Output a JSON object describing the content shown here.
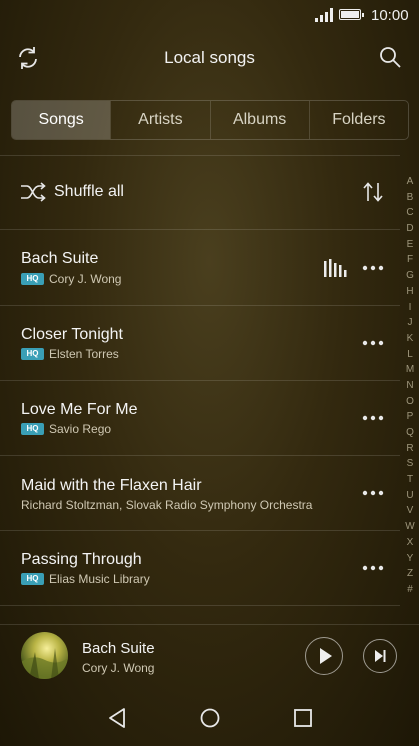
{
  "status_bar": {
    "time": "10:00"
  },
  "header": {
    "title": "Local songs"
  },
  "tabs": [
    {
      "label": "Songs",
      "selected": true
    },
    {
      "label": "Artists",
      "selected": false
    },
    {
      "label": "Albums",
      "selected": false
    },
    {
      "label": "Folders",
      "selected": false
    }
  ],
  "shuffle": {
    "label": "Shuffle all"
  },
  "songs": [
    {
      "title": "Bach Suite",
      "artist": "Cory J. Wong",
      "hq": "HQ",
      "playing": true
    },
    {
      "title": "Closer Tonight",
      "artist": "Elsten Torres",
      "hq": "HQ",
      "playing": false
    },
    {
      "title": "Love Me For Me",
      "artist": "Savio Rego",
      "hq": "HQ",
      "playing": false
    },
    {
      "title": "Maid with the Flaxen Hair",
      "artist": "Richard Stoltzman, Slovak Radio Symphony Orchestra",
      "hq": "",
      "playing": false
    },
    {
      "title": "Passing Through",
      "artist": "Elias Music Library",
      "hq": "HQ",
      "playing": false
    }
  ],
  "alphabet_index": [
    "A",
    "B",
    "C",
    "D",
    "E",
    "F",
    "G",
    "H",
    "I",
    "J",
    "K",
    "L",
    "M",
    "N",
    "O",
    "P",
    "Q",
    "R",
    "S",
    "T",
    "U",
    "V",
    "W",
    "X",
    "Y",
    "Z",
    "#"
  ],
  "now_playing": {
    "title": "Bach Suite",
    "artist": "Cory J. Wong"
  },
  "colors": {
    "hq_badge": "#3a9fb6",
    "background": "#33290f"
  },
  "icons": [
    "refresh-icon",
    "search-icon",
    "shuffle-icon",
    "sort-icon",
    "more-icon",
    "equalizer-icon",
    "play-icon",
    "next-icon",
    "back-icon",
    "home-icon",
    "recents-icon"
  ]
}
